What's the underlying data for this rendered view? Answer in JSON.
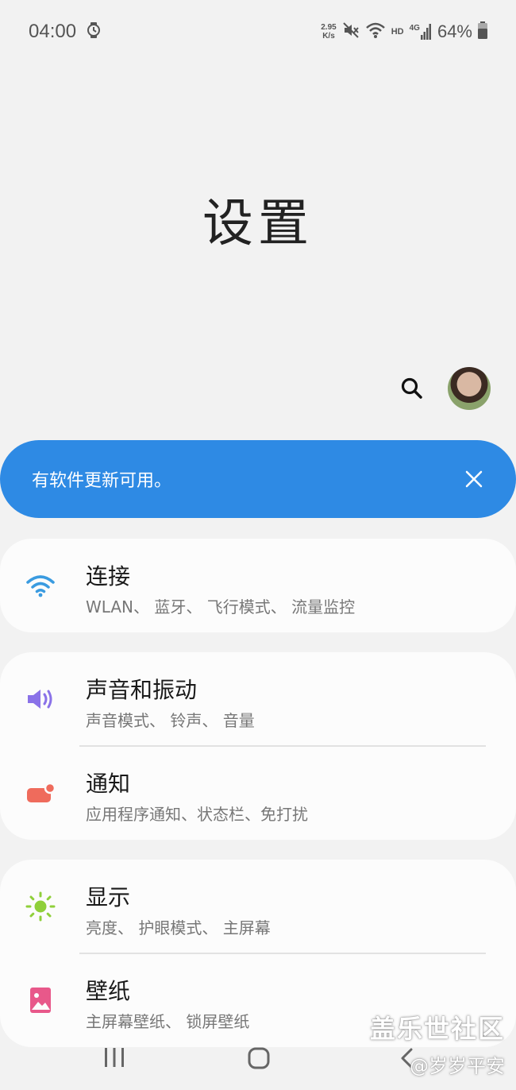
{
  "status_bar": {
    "time": "04:00",
    "speed_value": "2.95",
    "speed_unit": "K/s",
    "hd": "HD",
    "network": "4G",
    "battery": "64%"
  },
  "header": {
    "title": "设置"
  },
  "update_banner": {
    "text": "有软件更新可用。"
  },
  "cards": [
    {
      "items": [
        {
          "title": "连接",
          "subtitle": "WLAN、 蓝牙、 飞行模式、 流量监控",
          "icon": "wifi-icon",
          "color": "#3a9be0"
        }
      ]
    },
    {
      "items": [
        {
          "title": "声音和振动",
          "subtitle": "声音模式、 铃声、 音量",
          "icon": "volume-icon",
          "color": "#8a72e8"
        },
        {
          "title": "通知",
          "subtitle": "应用程序通知、状态栏、免打扰",
          "icon": "notification-icon",
          "color": "#ef6b5c"
        }
      ]
    },
    {
      "items": [
        {
          "title": "显示",
          "subtitle": "亮度、 护眼模式、 主屏幕",
          "icon": "brightness-icon",
          "color": "#8fcf3a"
        },
        {
          "title": "壁纸",
          "subtitle": "主屏幕壁纸、 锁屏壁纸",
          "icon": "wallpaper-icon",
          "color": "#e8588a"
        }
      ]
    }
  ],
  "watermark": {
    "title": "盖乐世社区",
    "user": "@岁岁平安"
  }
}
